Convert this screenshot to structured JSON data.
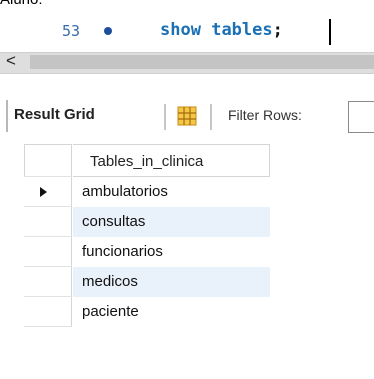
{
  "top_crop": "Aluno:",
  "editor": {
    "line_number": "53",
    "sql_keyword1": "show",
    "sql_keyword2": "tables",
    "sql_semicolon": ";"
  },
  "scrollbar": {
    "left_arrow": "<"
  },
  "toolbar": {
    "result_grid_label": "Result Grid",
    "filter_label": "Filter Rows:",
    "filter_value": ""
  },
  "table": {
    "column_header": "Tables_in_clinica",
    "rows": [
      "ambulatorios",
      "consultas",
      "funcionarios",
      "medicos",
      "paciente"
    ],
    "selected_row": "ambulatorios"
  },
  "colors": {
    "keyword": "#1a6fb5",
    "alt_row": "#e9f1fb",
    "line_number": "#3a6aa8"
  },
  "icons": [
    "breakpoint-dot-icon",
    "scroll-left-icon",
    "grid-view-icon",
    "row-selected-arrow-icon"
  ]
}
